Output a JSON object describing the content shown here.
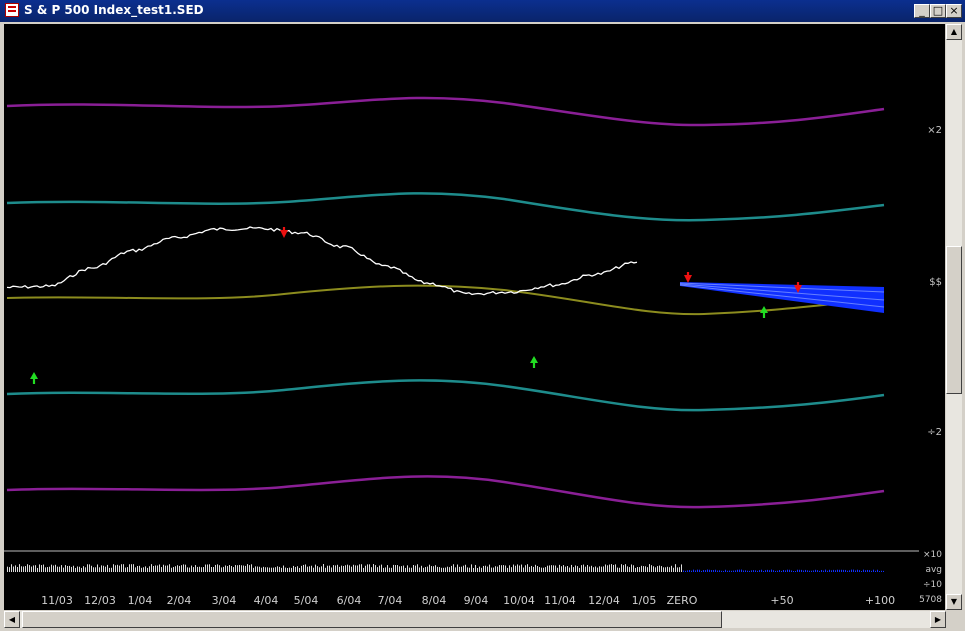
{
  "window": {
    "title": "S & P 500 Index_test1.SED",
    "minimize": "_",
    "maximize": "□",
    "close": "×"
  },
  "scale": {
    "upper": "×2",
    "mid": "$$",
    "lower": "÷2",
    "vol_upper": "×10",
    "vol_mid": "avg",
    "vol_lower": "÷10",
    "corner": "5708"
  },
  "x_labels": [
    "11/03",
    "12/03",
    "1/04",
    "2/04",
    "3/04",
    "4/04",
    "5/04",
    "6/04",
    "7/04",
    "8/04",
    "9/04",
    "10/04",
    "11/04",
    "12/04",
    "1/05",
    "ZERO",
    "+50",
    "+100"
  ],
  "colors": {
    "background": "#000000",
    "price": "#ffffff",
    "price_trend": "#1a3cff",
    "forecast": "#1030ff",
    "outer_band": "#8a1f96",
    "inner_band": "#1e8c8c",
    "center_line": "#8c8c1e",
    "buy_arrow": "#22dd22",
    "sell_arrow": "#ee1111"
  },
  "signals": {
    "buy_icon": "up-arrow",
    "sell_icon": "down-arrow"
  },
  "chart_data": {
    "type": "line",
    "x": [
      "11/03",
      "12/03",
      "1/04",
      "2/04",
      "3/04",
      "4/04",
      "5/04",
      "6/04",
      "7/04",
      "8/04",
      "9/04",
      "10/04",
      "11/04",
      "12/04",
      "1/05",
      "ZERO",
      "+50",
      "+100"
    ],
    "series": [
      {
        "values": [
          0.98,
          0.985,
          1.07,
          1.16,
          1.23,
          1.28,
          1.285,
          1.26,
          1.18,
          1.08,
          1.0,
          0.95,
          0.96,
          0.99,
          1.04,
          1.1,
          null,
          null
        ]
      }
    ],
    "y_scale": "log",
    "y_ticks": [
      "×2",
      "$$",
      "÷2"
    ]
  }
}
